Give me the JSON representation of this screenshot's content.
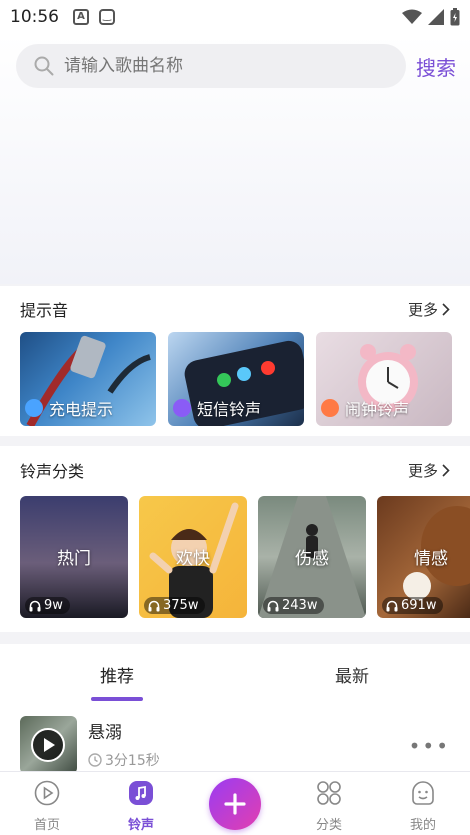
{
  "status": {
    "time": "10:56"
  },
  "search": {
    "placeholder": "请输入歌曲名称",
    "button": "搜索"
  },
  "prompt_tones": {
    "title": "提示音",
    "more": "更多",
    "items": [
      {
        "label": "充电提示",
        "icon_color": "#4aa3ff"
      },
      {
        "label": "短信铃声",
        "icon_color": "#8a5cf6"
      },
      {
        "label": "闹钟铃声",
        "icon_color": "#ff7a45"
      }
    ]
  },
  "categories": {
    "title": "铃声分类",
    "more": "更多",
    "items": [
      {
        "name": "热门",
        "count": "9w"
      },
      {
        "name": "欢快",
        "count": "375w"
      },
      {
        "name": "伤感",
        "count": "243w"
      },
      {
        "name": "情感",
        "count": "691w"
      }
    ]
  },
  "tabs": {
    "recommend": "推荐",
    "latest": "最新"
  },
  "songs": [
    {
      "title": "悬溺",
      "duration": "3分15秒"
    }
  ],
  "nav": {
    "home": "首页",
    "ringtone": "铃声",
    "category": "分类",
    "mine": "我的"
  },
  "colors": {
    "accent": "#7a4fd6"
  }
}
